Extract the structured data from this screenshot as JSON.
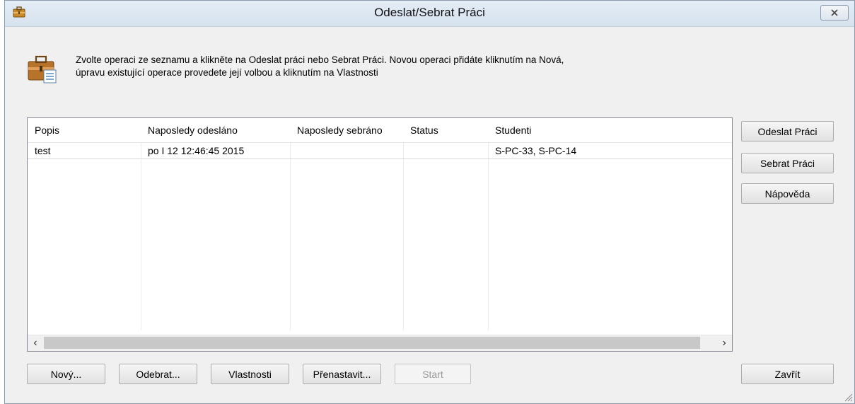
{
  "window": {
    "title": "Odeslat/Sebrat Práci",
    "icon": "briefcase-icon",
    "close_icon": "close-icon"
  },
  "instructions": {
    "line1": "Zvolte operaci ze seznamu a klikněte na Odeslat práci nebo Sebrat Práci. Novou operaci přidáte kliknutím na Nová,",
    "line2": "úpravu existující operace provedete její volbou a kliknutím na Vlastnosti"
  },
  "table": {
    "columns": [
      "Popis",
      "Naposledy odesláno",
      "Naposledy sebráno",
      "Status",
      "Studenti"
    ],
    "rows": [
      [
        "test",
        "po I 12 12:46:45 2015",
        "",
        "",
        "S-PC-33, S-PC-14"
      ]
    ]
  },
  "side_buttons": {
    "send": "Odeslat Práci",
    "collect": "Sebrat Práci",
    "help": "Nápověda"
  },
  "bottom_buttons": {
    "new": "Nový...",
    "remove": "Odebrat...",
    "properties": "Vlastnosti",
    "reset": "Přenastavit...",
    "start": "Start",
    "close": "Zavřít"
  },
  "colors": {
    "titlebar": "#dae5f0",
    "window_bg": "#f0f0f0",
    "list_bg": "#ffffff"
  }
}
